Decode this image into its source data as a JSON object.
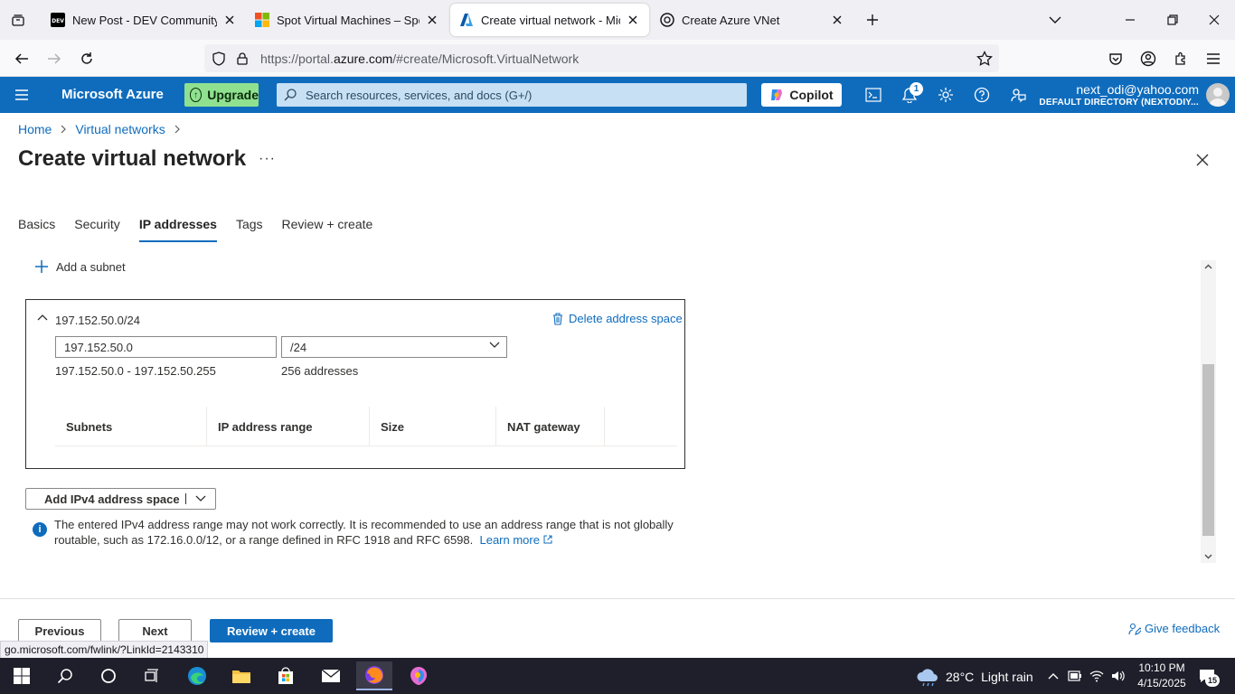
{
  "browser": {
    "tabs": [
      {
        "title": "New Post - DEV Community",
        "icon": "dev-logo-icon"
      },
      {
        "title": "Spot Virtual Machines – Spot Pr",
        "icon": "microsoft-logo-icon"
      },
      {
        "title": "Create virtual network - Microso",
        "icon": "azure-logo-icon",
        "active": true
      },
      {
        "title": "Create Azure VNet",
        "icon": "chatgpt-logo-icon"
      }
    ],
    "url_prefix": "https://portal.",
    "url_domain": "azure.com",
    "url_suffix": "/#create/Microsoft.VirtualNetwork",
    "status_url": "go.microsoft.com/fwlink/?LinkId=2143310"
  },
  "azure": {
    "brand": "Microsoft Azure",
    "upgrade_label": "Upgrade",
    "search_placeholder": "Search resources, services, and docs (G+/)",
    "copilot_label": "Copilot",
    "notification_count": "1",
    "account_email": "next_odi@yahoo.com",
    "account_directory": "DEFAULT DIRECTORY (NEXTODIY...",
    "colors": {
      "header": "#0f6cbd",
      "upgrade": "#8fe18f",
      "search": "#c7e0f4"
    }
  },
  "page": {
    "breadcrumb": [
      "Home",
      "Virtual networks"
    ],
    "title": "Create virtual network",
    "more_label": "···",
    "tabs": [
      "Basics",
      "Security",
      "IP addresses",
      "Tags",
      "Review + create"
    ],
    "selected_tab": "IP addresses",
    "add_subnet_label": "Add a subnet",
    "address_space": {
      "name": "197.152.50.0/24",
      "delete_label": "Delete address space",
      "ip_value": "197.152.50.0",
      "prefix_value": "/24",
      "range_text": "197.152.50.0 - 197.152.50.255",
      "count_text": "256 addresses",
      "columns": [
        "Subnets",
        "IP address range",
        "Size",
        "NAT gateway"
      ]
    },
    "add_ipv4_label": "Add IPv4 address space",
    "info_text": "The entered IPv4 address range may not work correctly. It is recommended to use an address range that is not globally routable, such as 172.16.0.0/12, or a range defined in RFC 1918 and RFC 6598.",
    "learn_more_label": "Learn more"
  },
  "footer": {
    "previous_label": "Previous",
    "next_label": "Next",
    "review_create_label": "Review + create",
    "feedback_label": "Give feedback"
  },
  "taskbar": {
    "weather_temp": "28°C",
    "weather_desc": "Light rain",
    "time": "10:10 PM",
    "date": "4/15/2025",
    "notification_count": "15"
  }
}
